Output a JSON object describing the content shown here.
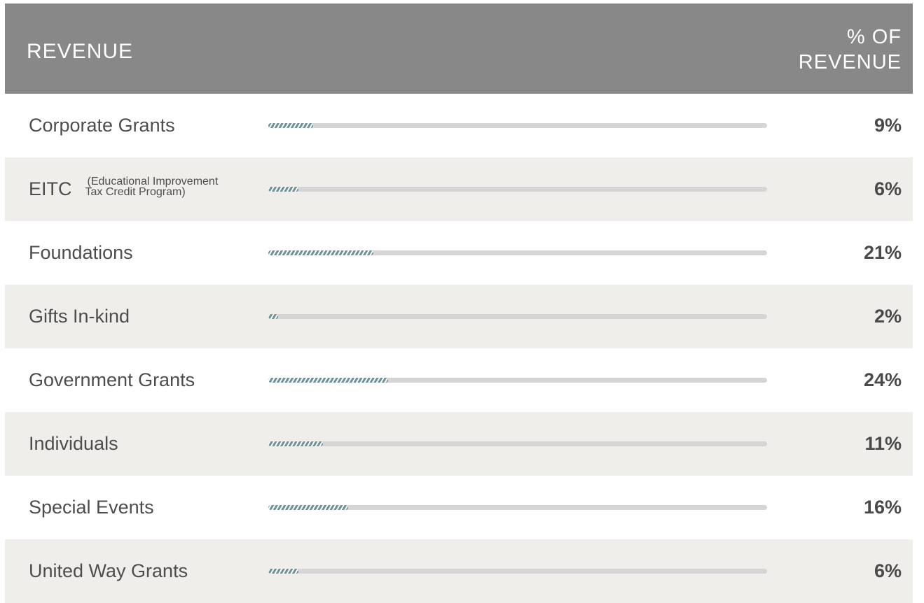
{
  "header": {
    "left": "REVENUE",
    "right_line1": "% OF",
    "right_line2": "REVENUE"
  },
  "colors": {
    "header_bg": "#888889",
    "bar_fill": "#6f9398",
    "bar_track": "#d5d5d5",
    "alt_row": "#f0eeeb"
  },
  "rows": [
    {
      "label": "Corporate Grants",
      "pct": "9%"
    },
    {
      "label": "EITC",
      "sub1": "(Educational Improvement",
      "sub2": "Tax Credit Program)",
      "pct": "6%"
    },
    {
      "label": "Foundations",
      "pct": "21%"
    },
    {
      "label": "Gifts In-kind",
      "pct": "2%"
    },
    {
      "label": "Government Grants",
      "pct": "24%"
    },
    {
      "label": "Individuals",
      "pct": "11%"
    },
    {
      "label": "Special Events",
      "pct": "16%"
    },
    {
      "label": "United Way Grants",
      "pct": "6%"
    }
  ],
  "chart_data": {
    "type": "bar",
    "categories": [
      "Corporate Grants",
      "EITC",
      "Foundations",
      "Gifts In-kind",
      "Government Grants",
      "Individuals",
      "Special Events",
      "United Way Grants"
    ],
    "values": [
      9,
      6,
      21,
      2,
      24,
      11,
      16,
      6
    ],
    "xlabel": "REVENUE",
    "ylabel": "% OF REVENUE",
    "ylim": [
      0,
      100
    ]
  }
}
